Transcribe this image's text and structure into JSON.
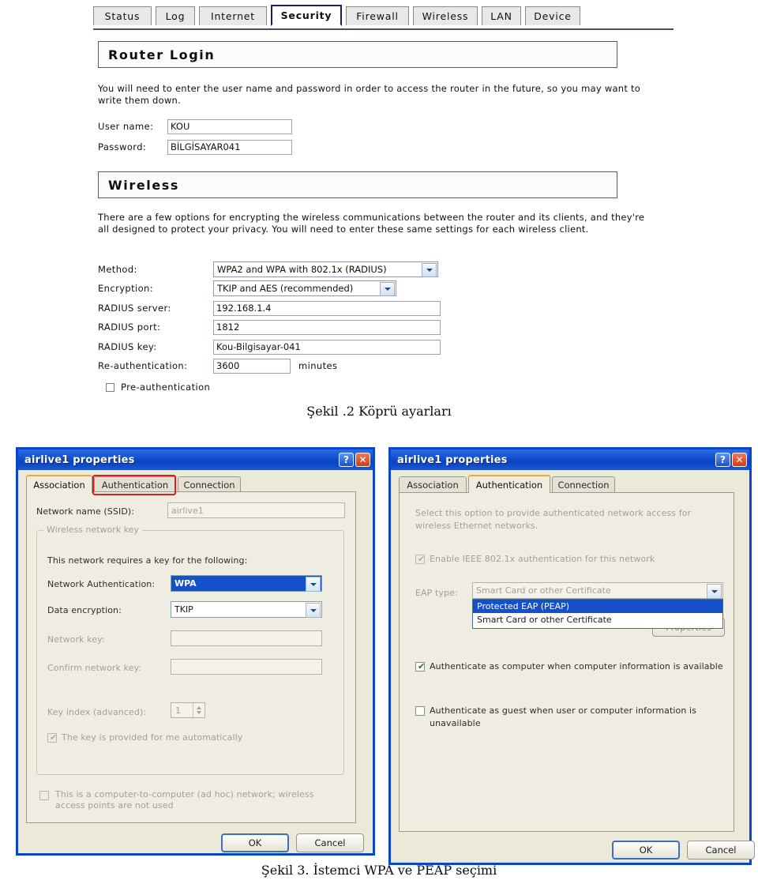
{
  "router_page": {
    "tabs": [
      {
        "label": "Status",
        "active": false
      },
      {
        "label": "Log",
        "active": false
      },
      {
        "label": "Internet",
        "active": false
      },
      {
        "label": "Security",
        "active": true
      },
      {
        "label": "Firewall",
        "active": false
      },
      {
        "label": "Wireless",
        "active": false
      },
      {
        "label": "LAN",
        "active": false
      },
      {
        "label": "Device",
        "active": false
      }
    ],
    "login_section": {
      "title": "Router Login",
      "description": "You will need to enter the user name and password in order to access the router in the future, so you may want to write them down.",
      "username_label": "User name:",
      "username_value": "KOU",
      "password_label": "Password:",
      "password_value": "BİLGİSAYAR041"
    },
    "wireless_section": {
      "title": "Wireless",
      "description": "There are a few options for encrypting the wireless communications between the router and its clients, and they're all designed to protect your privacy. You will need to enter these same settings for each wireless client.",
      "method_label": "Method:",
      "method_value": "WPA2 and WPA with 802.1x (RADIUS)",
      "encryption_label": "Encryption:",
      "encryption_value": "TKIP and AES (recommended)",
      "radius_server_label": "RADIUS server:",
      "radius_server_value": "192.168.1.4",
      "radius_port_label": "RADIUS port:",
      "radius_port_value": "1812",
      "radius_key_label": "RADIUS key:",
      "radius_key_value": "Kou-Bilgisayar-041",
      "reauth_label": "Re-authentication:",
      "reauth_value": "3600",
      "reauth_unit": "minutes",
      "preauth_label": "Pre-authentication",
      "preauth_checked": false
    },
    "caption": "Şekil .2 Köprü ayarları"
  },
  "left_dialog": {
    "title": "airlive1 properties",
    "help_glyph": "?",
    "close_glyph": "✕",
    "tabs": [
      {
        "label": "Association",
        "active": true
      },
      {
        "label": "Authentication",
        "active": false
      },
      {
        "label": "Connection",
        "active": false
      }
    ],
    "ssid_label": "Network name (SSID):",
    "ssid_value": "airlive1",
    "group_title": "Wireless network key",
    "requires_key_text": "This network requires a key for the following:",
    "net_auth_label": "Network Authentication:",
    "net_auth_value": "WPA",
    "data_encryption_label": "Data encryption:",
    "data_encryption_value": "TKIP",
    "network_key_label": "Network key:",
    "network_key_value": "",
    "confirm_key_label": "Confirm network key:",
    "confirm_key_value": "",
    "key_index_label": "Key index (advanced):",
    "key_index_value": "1",
    "auto_key_label": "The key is provided for me automatically",
    "auto_key_checked": true,
    "adhoc_label": "This is a computer-to-computer (ad hoc) network; wireless access points are not used",
    "adhoc_checked": false,
    "ok_label": "OK",
    "cancel_label": "Cancel"
  },
  "right_dialog": {
    "title": "airlive1 properties",
    "help_glyph": "?",
    "close_glyph": "✕",
    "tabs": [
      {
        "label": "Association",
        "active": false
      },
      {
        "label": "Authentication",
        "active": true
      },
      {
        "label": "Connection",
        "active": false
      }
    ],
    "description": "Select this option to provide authenticated network access for wireless Ethernet networks.",
    "enable_8021x_label": "Enable IEEE 802.1x authentication for this network",
    "enable_8021x_checked": true,
    "eap_type_label": "EAP type:",
    "eap_type_value": "Smart Card or other Certificate",
    "eap_options": [
      {
        "label": "Protected EAP (PEAP)",
        "highlighted": true
      },
      {
        "label": "Smart Card or other Certificate",
        "highlighted": false
      }
    ],
    "properties_label": "Properties",
    "auth_computer_label": "Authenticate as computer when computer information is available",
    "auth_computer_checked": true,
    "auth_guest_label": "Authenticate as guest when user or computer information is unavailable",
    "auth_guest_checked": false,
    "ok_label": "OK",
    "cancel_label": "Cancel"
  },
  "bottom_caption": "Şekil 3. İstemci WPA ve PEAP seçimi",
  "colors": {
    "active_tab_border": "#1c1c6e",
    "xp_title_blue": "#0a44c2",
    "selection_blue": "#1450c8",
    "annotation_red": "#d92020"
  }
}
